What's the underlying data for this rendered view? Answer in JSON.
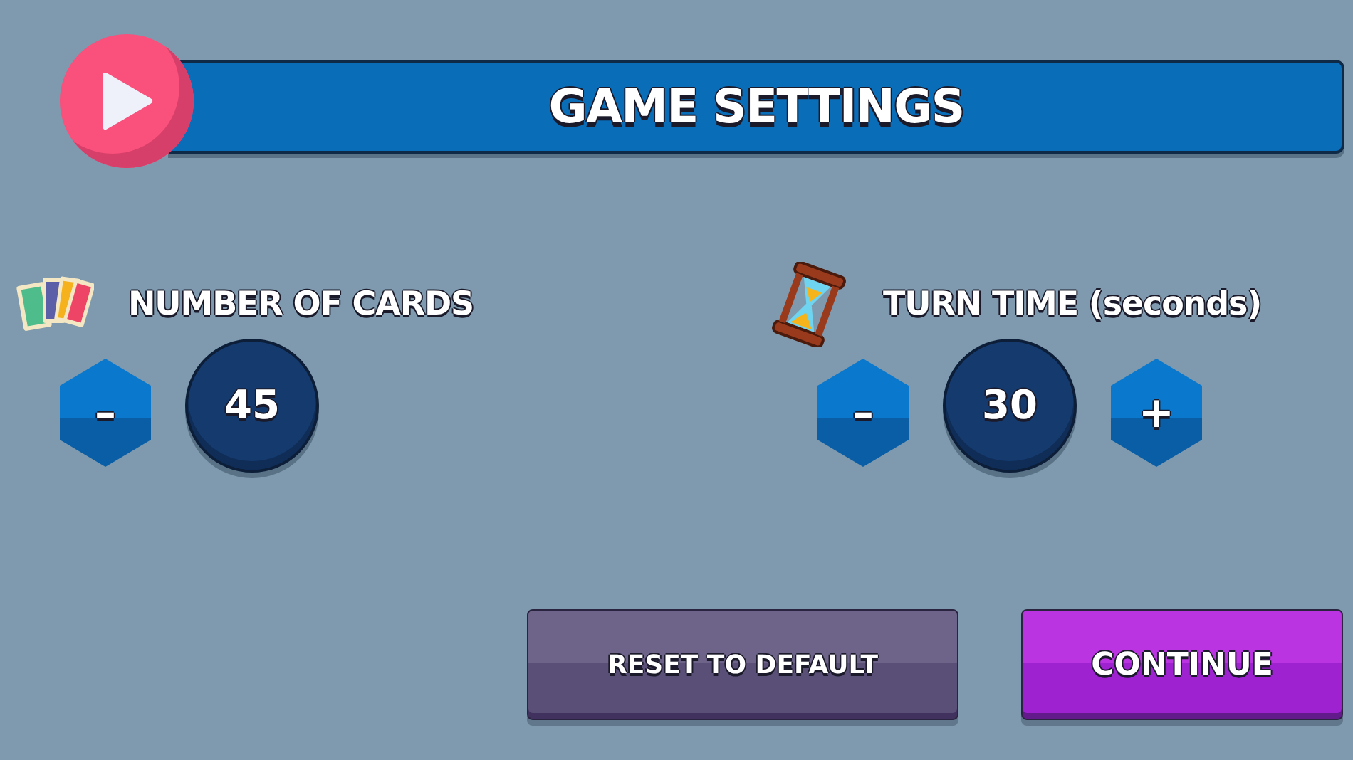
{
  "title": "GAME SETTINGS",
  "settings": [
    {
      "kind": "cards",
      "label": "NUMBER OF CARDS",
      "value": "45",
      "controls": [
        {
          "kind": "minus",
          "symbol": "–"
        }
      ]
    },
    {
      "kind": "hourglass",
      "label": "TURN TIME (seconds)",
      "value": "30",
      "controls": [
        {
          "kind": "minus",
          "symbol": "–"
        },
        {
          "kind": "plus",
          "symbol": "+"
        }
      ]
    }
  ],
  "buttons": [
    {
      "kind": "secondary",
      "label": "RESET TO DEFAULT"
    },
    {
      "kind": "primary",
      "label": "CONTINUE"
    }
  ]
}
